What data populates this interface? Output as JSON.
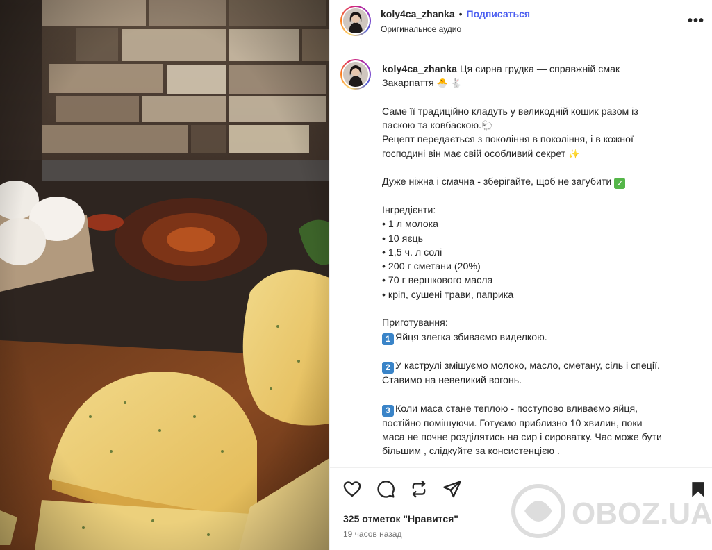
{
  "post": {
    "username": "koly4ca_zhanka",
    "follow_label": "Подписаться",
    "separator": "•",
    "audio": "Оригинальное аудио",
    "more_label": "•••"
  },
  "caption": {
    "username": "koly4ca_zhanka",
    "lines": [
      "Ця сирна грудка — справжній смак",
      "Закарпаття",
      "",
      "Саме її традиційно кладуть у великодній кошик разом із",
      "паскою та ковбаскою.",
      "Рецепт передається з покоління в покоління, і в кожної",
      "господині він має свій особливий секрет",
      "",
      "Дуже ніжна і смачна - зберігайте, щоб не загубити",
      "",
      "Інгредієнти:",
      "• 1 л молока",
      "• 10 яєць",
      "• 1,5 ч. л солі",
      "• 200 г сметани (20%)",
      "• 70 г вершкового масла",
      "• кріп, сушені трави, паприка",
      "",
      "Приготування:",
      "Яйця злегка збиваємо виделкою.",
      "",
      "У каструлі змішуємо молоко, масло, сметану, сіль і спеції.",
      "Ставимо на невеликий вогонь.",
      "",
      "Коли маса стане теплою - поступово вливаємо яйця,",
      "постійно помішуючи. Готуємо приблизно 10 хвилин, поки",
      "маса не почне розділятись на сир і сироватку. Час може бути",
      "більшим , слідкуйте за консистенцією ."
    ],
    "emoji": {
      "line2": "🐣 🐇",
      "line5": "🐑",
      "line7": "✨",
      "line9": "✓",
      "step1": "1",
      "step2": "2",
      "step3": "3"
    }
  },
  "footer": {
    "likes": "325 отметок \"Нравится\"",
    "time": "19 часов назад",
    "watermark": "OBOZ.UA"
  },
  "icons": [
    "heart-icon",
    "comment-icon",
    "repost-icon",
    "share-icon",
    "bookmark-icon",
    "more-icon"
  ],
  "colors": {
    "follow": "#4a5df0",
    "text": "#262626",
    "muted": "#737373",
    "border": "#efefef"
  }
}
